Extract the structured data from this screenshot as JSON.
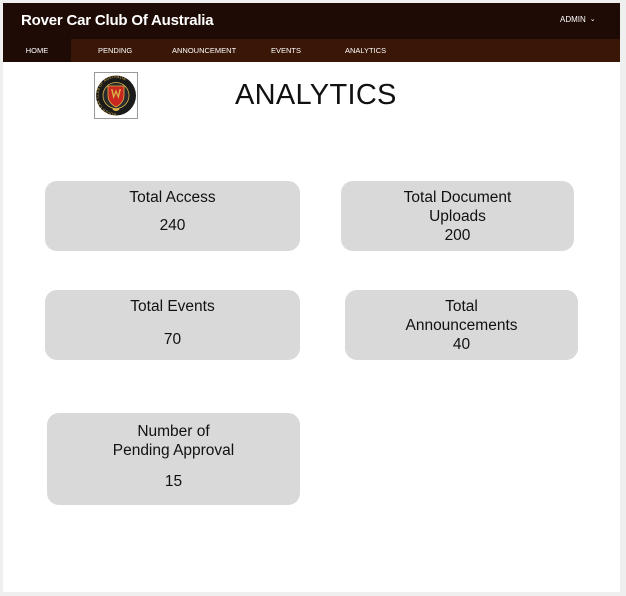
{
  "header": {
    "brand": "Rover Car Club Of Australia",
    "user_menu": "ADMIN"
  },
  "nav": {
    "items": [
      {
        "label": "HOME",
        "active": true
      },
      {
        "label": "PENDING",
        "active": false
      },
      {
        "label": "ANNOUNCEMENT",
        "active": false
      },
      {
        "label": "EVENTS",
        "active": false
      },
      {
        "label": "ANALYTICS",
        "active": false
      }
    ]
  },
  "logo": {
    "ring_text": "ROVER CAR CLUB OF AUSTRALIA",
    "colors": {
      "ring": "#1a1a1a",
      "shield": "#c8261e",
      "gold": "#d9b24a"
    }
  },
  "page": {
    "title": "ANALYTICS"
  },
  "stats": {
    "total_access": {
      "label": "Total Access",
      "value": "240"
    },
    "total_document_uploads": {
      "label_line1": "Total Document",
      "label_line2": "Uploads",
      "value": "200"
    },
    "total_events": {
      "label": "Total Events",
      "value": "70"
    },
    "total_announcements": {
      "label_line1": "Total",
      "label_line2": "Announcements",
      "value": "40"
    },
    "pending_approval": {
      "label_line1": "Number of",
      "label_line2": "Pending Approval",
      "value": "15"
    }
  },
  "colors": {
    "topbar": "#1f0b05",
    "navbar": "#3a1606",
    "card": "#d9d9d9"
  }
}
